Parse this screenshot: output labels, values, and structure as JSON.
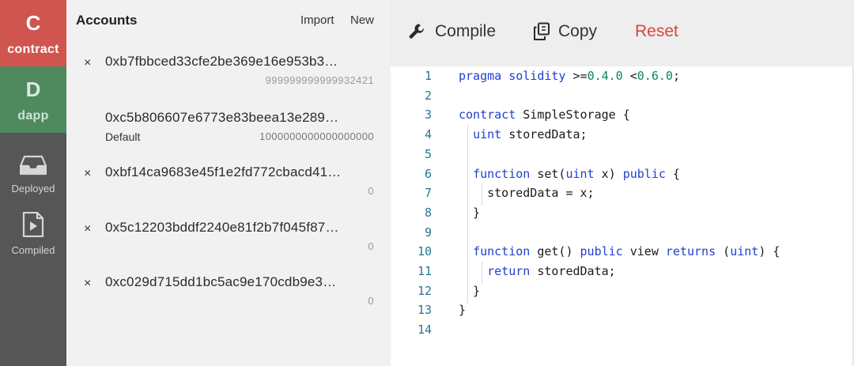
{
  "rail": {
    "contract": {
      "letter": "C",
      "label": "contract",
      "color": "#d0554f"
    },
    "dapp": {
      "letter": "D",
      "label": "dapp",
      "color": "#4f8a5e"
    },
    "deployed": {
      "label": "Deployed",
      "icon": "inbox-icon"
    },
    "compiled": {
      "label": "Compiled",
      "icon": "file-play-icon"
    }
  },
  "accounts": {
    "title": "Accounts",
    "import_label": "Import",
    "new_label": "New",
    "items": [
      {
        "remove": "×",
        "address": "0xb7fbbced33cfe2be369e16e953b3…",
        "balance": "999999999999932421",
        "default_label": ""
      },
      {
        "remove": "",
        "address": "0xc5b806607e6773e83beea13e289…",
        "balance": "1000000000000000000",
        "default_label": "Default"
      },
      {
        "remove": "×",
        "address": "0xbf14ca9683e45f1e2fd772cbacd41…",
        "balance": "0",
        "default_label": ""
      },
      {
        "remove": "×",
        "address": "0x5c12203bddf2240e81f2b7f045f87…",
        "balance": "0",
        "default_label": ""
      },
      {
        "remove": "×",
        "address": "0xc029d715dd1bc5ac9e170cdb9e3…",
        "balance": "0",
        "default_label": ""
      }
    ]
  },
  "toolbar": {
    "compile_label": "Compile",
    "copy_label": "Copy",
    "reset_label": "Reset",
    "compile_icon": "wrench-icon",
    "copy_icon": "copy-icon",
    "reset_color": "#d9453f"
  },
  "editor": {
    "line_numbers": [
      "1",
      "2",
      "3",
      "4",
      "5",
      "6",
      "7",
      "8",
      "9",
      "10",
      "11",
      "12",
      "13",
      "14"
    ],
    "lines": [
      [
        {
          "t": "pragma solidity ",
          "k": "kw"
        },
        {
          "t": ">=",
          "k": ""
        },
        {
          "t": "0.4.0",
          "k": "num"
        },
        {
          "t": " <",
          "k": ""
        },
        {
          "t": "0.6.0",
          "k": "num"
        },
        {
          "t": ";",
          "k": ""
        }
      ],
      [],
      [
        {
          "t": "contract",
          "k": "kw"
        },
        {
          "t": " SimpleStorage {",
          "k": ""
        }
      ],
      [
        {
          "t": "  ",
          "k": ""
        },
        {
          "t": "uint",
          "k": "kw"
        },
        {
          "t": " storedData;",
          "k": ""
        }
      ],
      [],
      [
        {
          "t": "  ",
          "k": ""
        },
        {
          "t": "function",
          "k": "kw"
        },
        {
          "t": " set(",
          "k": ""
        },
        {
          "t": "uint",
          "k": "kw"
        },
        {
          "t": " x) ",
          "k": ""
        },
        {
          "t": "public",
          "k": "kw"
        },
        {
          "t": " {",
          "k": ""
        }
      ],
      [
        {
          "t": "    storedData = x;",
          "k": ""
        }
      ],
      [
        {
          "t": "  }",
          "k": ""
        }
      ],
      [],
      [
        {
          "t": "  ",
          "k": ""
        },
        {
          "t": "function",
          "k": "kw"
        },
        {
          "t": " get() ",
          "k": ""
        },
        {
          "t": "public",
          "k": "kw"
        },
        {
          "t": " view ",
          "k": ""
        },
        {
          "t": "returns",
          "k": "kw"
        },
        {
          "t": " (",
          "k": ""
        },
        {
          "t": "uint",
          "k": "kw"
        },
        {
          "t": ") {",
          "k": ""
        }
      ],
      [
        {
          "t": "    ",
          "k": ""
        },
        {
          "t": "return",
          "k": "kw"
        },
        {
          "t": " storedData;",
          "k": ""
        }
      ],
      [
        {
          "t": "  }",
          "k": ""
        }
      ],
      [
        {
          "t": "}",
          "k": ""
        }
      ],
      []
    ]
  }
}
